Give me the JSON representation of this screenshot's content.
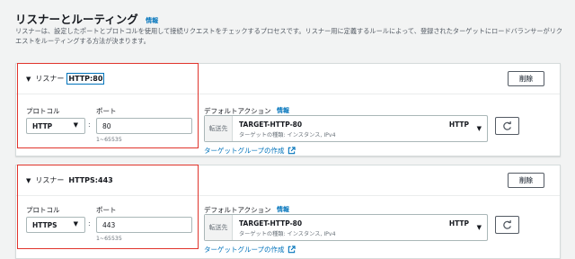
{
  "section": {
    "title": "リスナーとルーティング",
    "info": "情報",
    "description": "リスナーは、設定したポートとプロトコルを使用して接続リクエストをチェックするプロセスです。リスナー用に定義するルールによって、登録されたターゲットにロードバランサーがリクエストをルーティングする方法が決まります。"
  },
  "listeners": [
    {
      "toggle_prefix": "リスナー",
      "protocol_port_label": "HTTP:80",
      "delete_label": "削除",
      "protocol_label": "プロトコル",
      "protocol_value": "HTTP",
      "port_label": "ポート",
      "port_value": "80",
      "port_hint": "1~65535",
      "default_action_label": "デフォルトアクション",
      "info": "情報",
      "forward_label": "転送先",
      "target_group": "TARGET-HTTP-80",
      "target_type": "ターゲットの種類: インスタンス, IPv4",
      "target_protocol": "HTTP",
      "create_tg_link": "ターゲットグループの作成"
    },
    {
      "toggle_prefix": "リスナー",
      "protocol_port_label": "HTTPS:443",
      "delete_label": "削除",
      "protocol_label": "プロトコル",
      "protocol_value": "HTTPS",
      "port_label": "ポート",
      "port_value": "443",
      "port_hint": "1~65535",
      "default_action_label": "デフォルトアクション",
      "info": "情報",
      "forward_label": "転送先",
      "target_group": "TARGET-HTTP-80",
      "target_type": "ターゲットの種類: インスタンス, IPv4",
      "target_protocol": "HTTP",
      "create_tg_link": "ターゲットグループの作成"
    }
  ],
  "icons": {
    "caret": "▼",
    "dropdown": "▼",
    "refresh": "refresh-icon",
    "external": "external-link-icon"
  },
  "colors": {
    "link": "#0073bb",
    "highlight": "#e0342c",
    "background": "#f2f3f3"
  }
}
